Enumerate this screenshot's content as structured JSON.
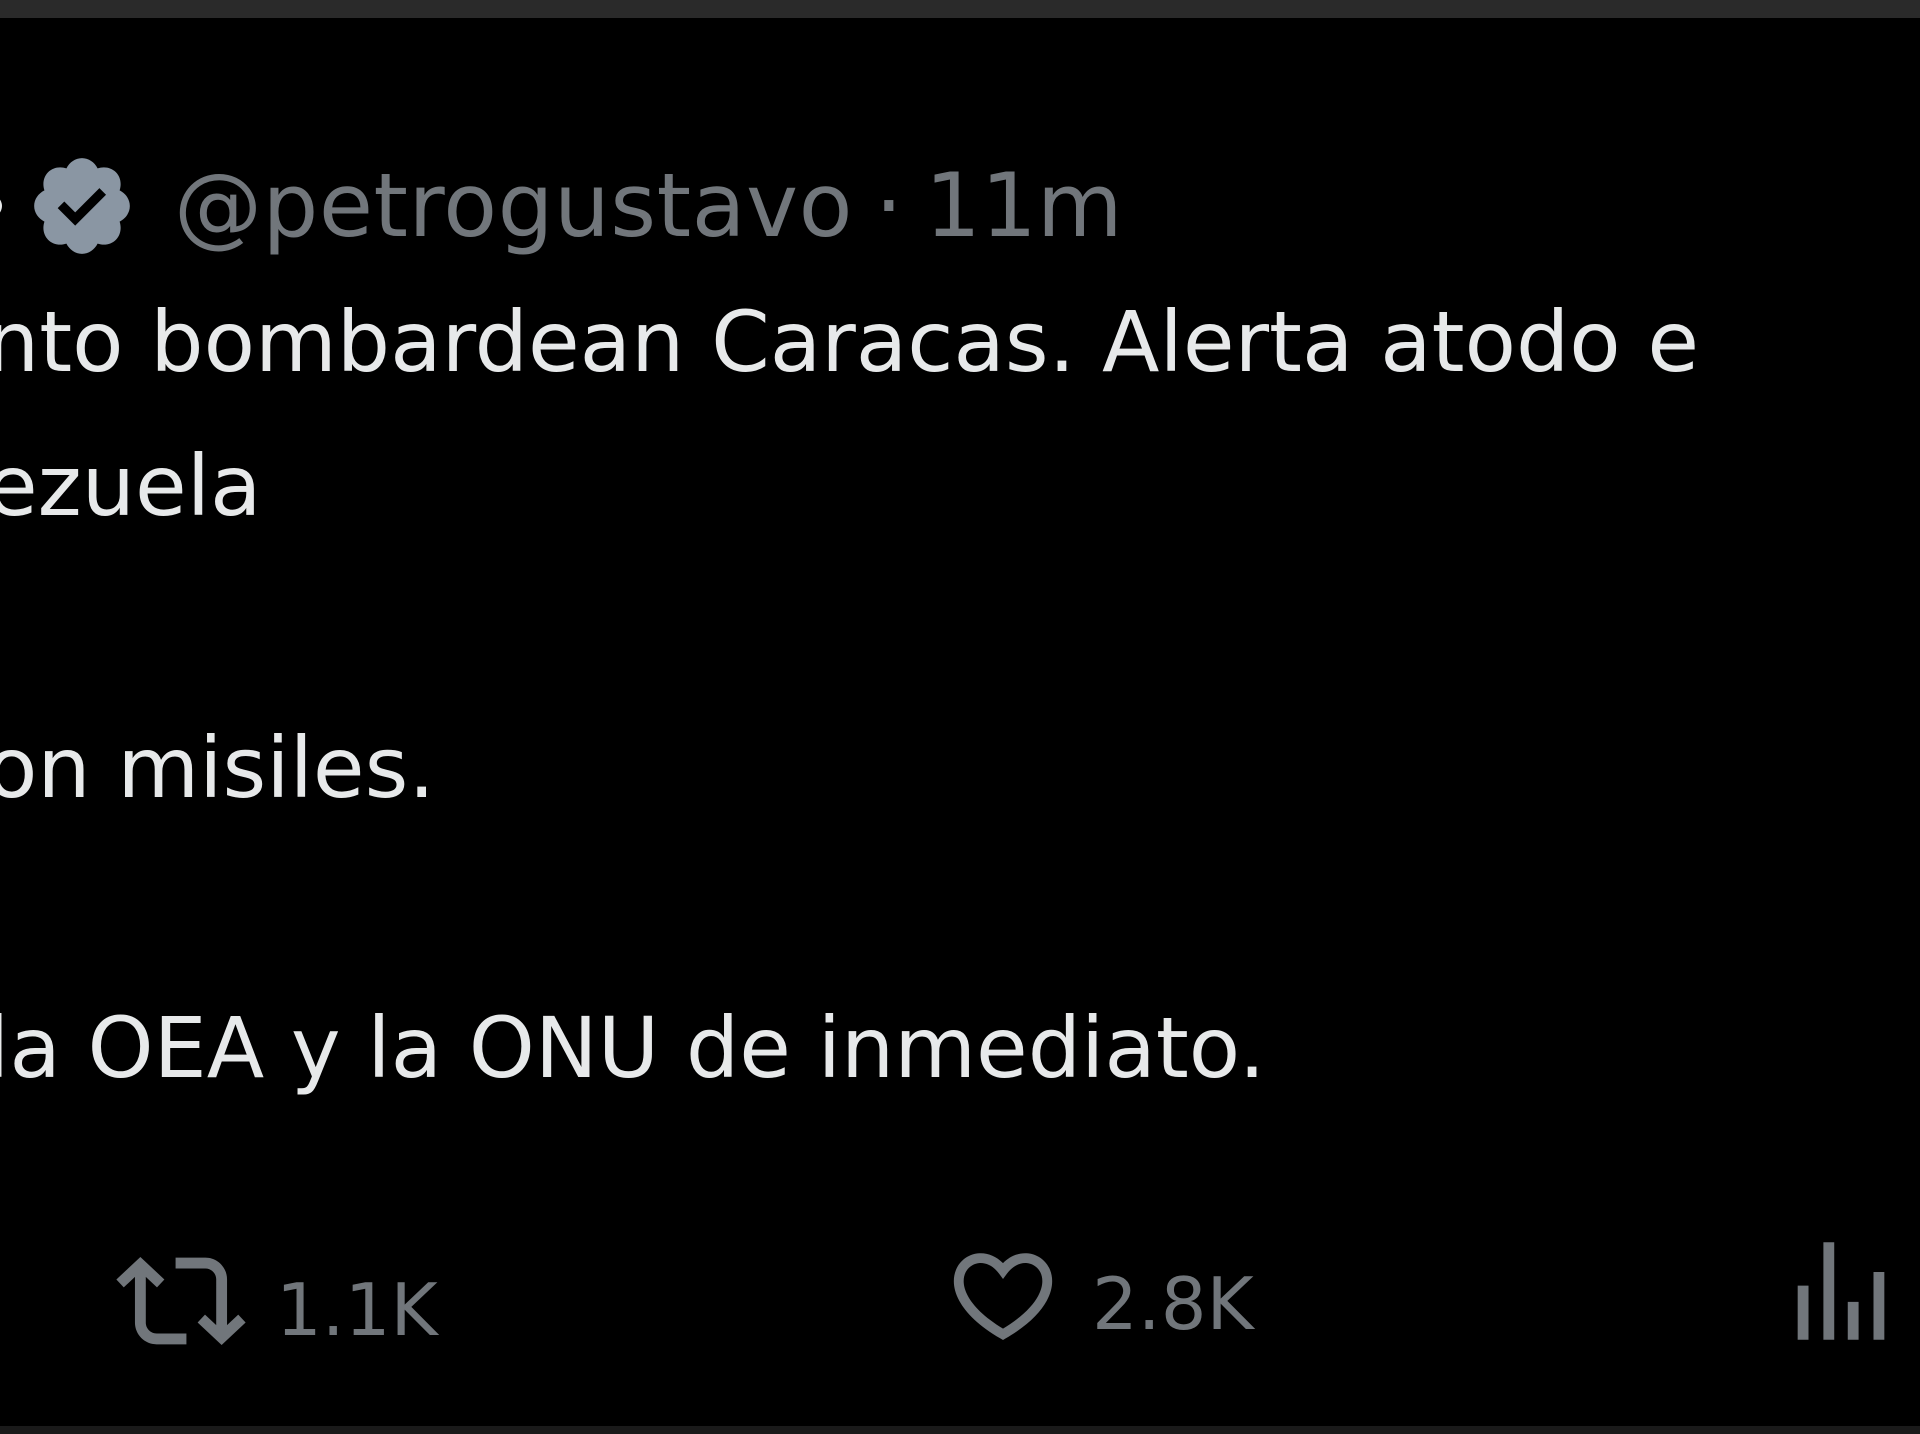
{
  "tweet": {
    "handle": "@petrogustavo",
    "separator": "·",
    "timestamp": "11m",
    "body_lines": [
      "nto bombardean Caracas. Alerta atodo e",
      "ezuela",
      "on misiles.",
      "la OEA y la ONU de inmediato."
    ]
  },
  "actions": {
    "retweet_count": "1.1K",
    "like_count": "2.8K"
  },
  "icons": {
    "verified": "verified-badge-icon",
    "retweet": "retweet-icon",
    "like": "heart-icon",
    "views": "analytics-icon"
  },
  "colors": {
    "background": "#000000",
    "text": "#e7e9ea",
    "muted": "#71767b"
  }
}
